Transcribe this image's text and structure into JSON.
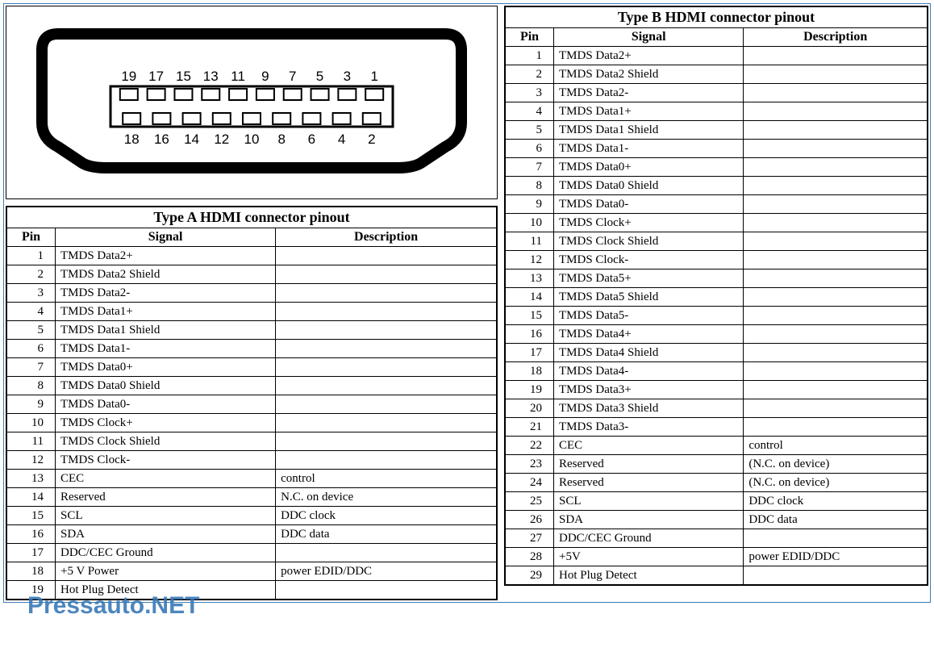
{
  "watermark": "Pressauto.NET",
  "connector_diagram": {
    "top_row_labels": [
      "19",
      "17",
      "15",
      "13",
      "11",
      "9",
      "7",
      "5",
      "3",
      "1"
    ],
    "bottom_row_labels": [
      "18",
      "16",
      "14",
      "12",
      "10",
      "8",
      "6",
      "4",
      "2"
    ]
  },
  "tableA": {
    "title": "Type A HDMI connector pinout",
    "headers": {
      "pin": "Pin",
      "signal": "Signal",
      "description": "Description"
    },
    "rows": [
      {
        "pin": "1",
        "signal": "TMDS Data2+",
        "description": ""
      },
      {
        "pin": "2",
        "signal": "TMDS Data2 Shield",
        "description": ""
      },
      {
        "pin": "3",
        "signal": "TMDS Data2-",
        "description": ""
      },
      {
        "pin": "4",
        "signal": "TMDS Data1+",
        "description": ""
      },
      {
        "pin": "5",
        "signal": "TMDS Data1 Shield",
        "description": ""
      },
      {
        "pin": "6",
        "signal": "TMDS Data1-",
        "description": ""
      },
      {
        "pin": "7",
        "signal": "TMDS Data0+",
        "description": ""
      },
      {
        "pin": "8",
        "signal": "TMDS Data0 Shield",
        "description": ""
      },
      {
        "pin": "9",
        "signal": "TMDS Data0-",
        "description": ""
      },
      {
        "pin": "10",
        "signal": "TMDS Clock+",
        "description": ""
      },
      {
        "pin": "11",
        "signal": "TMDS Clock Shield",
        "description": ""
      },
      {
        "pin": "12",
        "signal": "TMDS Clock-",
        "description": ""
      },
      {
        "pin": "13",
        "signal": "CEC",
        "description": "control"
      },
      {
        "pin": "14",
        "signal": "Reserved",
        "description": "N.C. on device"
      },
      {
        "pin": "15",
        "signal": "SCL",
        "description": "DDC clock"
      },
      {
        "pin": "16",
        "signal": "SDA",
        "description": "DDC data"
      },
      {
        "pin": "17",
        "signal": "DDC/CEC Ground",
        "description": ""
      },
      {
        "pin": "18",
        "signal": "+5 V Power",
        "description": "power EDID/DDC"
      },
      {
        "pin": "19",
        "signal": "Hot Plug Detect",
        "description": ""
      }
    ]
  },
  "tableB": {
    "title": "Type B HDMI connector pinout",
    "headers": {
      "pin": "Pin",
      "signal": "Signal",
      "description": "Description"
    },
    "rows": [
      {
        "pin": "1",
        "signal": "TMDS Data2+",
        "description": ""
      },
      {
        "pin": "2",
        "signal": "TMDS Data2 Shield",
        "description": ""
      },
      {
        "pin": "3",
        "signal": "TMDS Data2-",
        "description": ""
      },
      {
        "pin": "4",
        "signal": "TMDS Data1+",
        "description": ""
      },
      {
        "pin": "5",
        "signal": "TMDS Data1 Shield",
        "description": ""
      },
      {
        "pin": "6",
        "signal": "TMDS Data1-",
        "description": ""
      },
      {
        "pin": "7",
        "signal": "TMDS Data0+",
        "description": ""
      },
      {
        "pin": "8",
        "signal": "TMDS Data0 Shield",
        "description": ""
      },
      {
        "pin": "9",
        "signal": "TMDS Data0-",
        "description": ""
      },
      {
        "pin": "10",
        "signal": "TMDS Clock+",
        "description": ""
      },
      {
        "pin": "11",
        "signal": "TMDS Clock Shield",
        "description": ""
      },
      {
        "pin": "12",
        "signal": "TMDS Clock-",
        "description": ""
      },
      {
        "pin": "13",
        "signal": "TMDS Data5+",
        "description": ""
      },
      {
        "pin": "14",
        "signal": "TMDS Data5 Shield",
        "description": ""
      },
      {
        "pin": "15",
        "signal": "TMDS Data5-",
        "description": ""
      },
      {
        "pin": "16",
        "signal": "TMDS Data4+",
        "description": ""
      },
      {
        "pin": "17",
        "signal": "TMDS Data4 Shield",
        "description": ""
      },
      {
        "pin": "18",
        "signal": "TMDS Data4-",
        "description": ""
      },
      {
        "pin": "19",
        "signal": "TMDS Data3+",
        "description": ""
      },
      {
        "pin": "20",
        "signal": "TMDS Data3 Shield",
        "description": ""
      },
      {
        "pin": "21",
        "signal": "TMDS Data3-",
        "description": ""
      },
      {
        "pin": "22",
        "signal": "CEC",
        "description": "control"
      },
      {
        "pin": "23",
        "signal": "Reserved",
        "description": "(N.C. on device)"
      },
      {
        "pin": "24",
        "signal": "Reserved",
        "description": "(N.C. on device)"
      },
      {
        "pin": "25",
        "signal": "SCL",
        "description": "DDC clock"
      },
      {
        "pin": "26",
        "signal": "SDA",
        "description": "DDC data"
      },
      {
        "pin": "27",
        "signal": "DDC/CEC Ground",
        "description": ""
      },
      {
        "pin": "28",
        "signal": "+5V",
        "description": "power EDID/DDC"
      },
      {
        "pin": "29",
        "signal": "Hot Plug Detect",
        "description": ""
      }
    ]
  }
}
